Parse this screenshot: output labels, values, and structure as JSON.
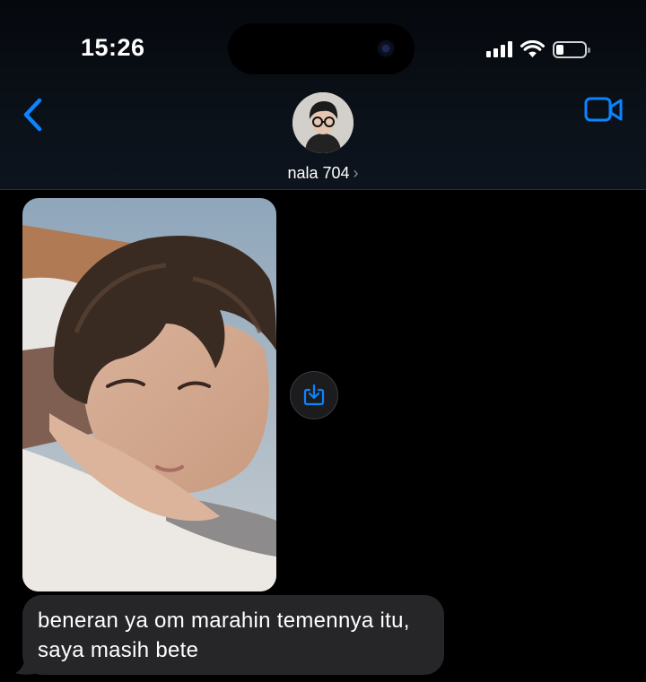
{
  "status_bar": {
    "time": "15:26",
    "signal_bars": 4,
    "battery_level": 0.2
  },
  "header": {
    "contact_name": "nala 704",
    "back_icon": "chevron-left-icon",
    "video_icon": "video-camera-icon",
    "name_chevron": "›"
  },
  "messages": [
    {
      "type": "image",
      "direction": "incoming",
      "description_icon": "photo"
    },
    {
      "type": "text",
      "direction": "incoming",
      "text": "beneran ya om marahin temennya itu, saya masih bete"
    }
  ],
  "save_button": {
    "icon": "save-download-icon"
  },
  "colors": {
    "accent": "#0a84ff",
    "bubble_incoming": "#262628",
    "background": "#000000"
  }
}
